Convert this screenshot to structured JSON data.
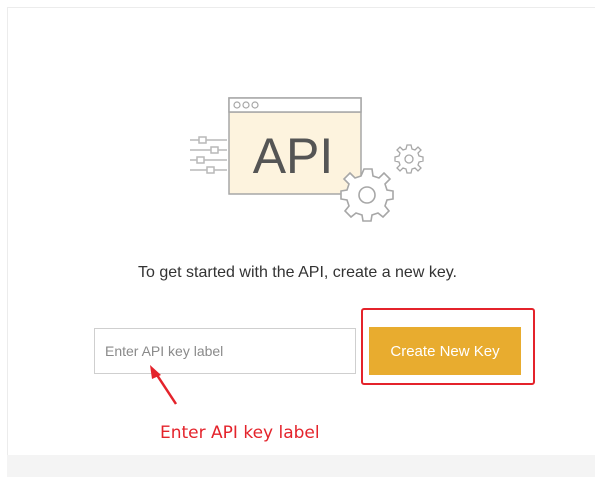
{
  "illustration": {
    "window_text": "API",
    "window_dots": "○○○",
    "icons": [
      "api-window-icon",
      "circuit-lines-icon",
      "gear-icon",
      "small-gear-icon"
    ]
  },
  "tagline": "To get started with the API, create a new key.",
  "key_form": {
    "input_placeholder": "Enter API key label",
    "input_value": "",
    "create_button_label": "Create New Key"
  },
  "annotation": {
    "label": "Enter API key label",
    "color": "#e4232b"
  },
  "colors": {
    "accent": "#e8ac2f",
    "annotation": "#e4232b",
    "window_fill": "#fdf3de"
  }
}
